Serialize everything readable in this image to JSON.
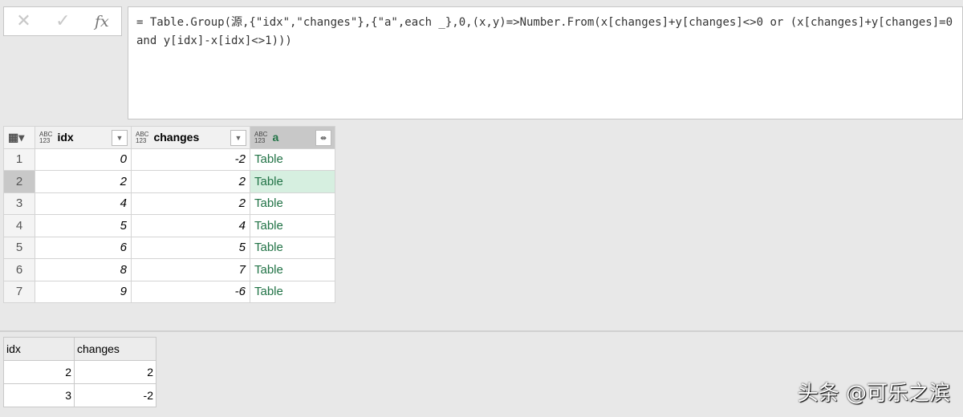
{
  "formula_bar": {
    "cancel": "✕",
    "confirm": "✓",
    "fx": "fx",
    "text": "= Table.Group(源,{\"idx\",\"changes\"},{\"a\",each _},0,(x,y)=>Number.From(x[changes]+y[changes]<>0 or (x[changes]+y[changes]=0 and y[idx]-x[idx]<>1)))"
  },
  "grid": {
    "type_label": "ABC\n123",
    "columns": [
      "idx",
      "changes",
      "a"
    ],
    "rows": [
      [
        "1",
        "0",
        "-2",
        "Table"
      ],
      [
        "2",
        "2",
        "2",
        "Table"
      ],
      [
        "3",
        "4",
        "2",
        "Table"
      ],
      [
        "4",
        "5",
        "4",
        "Table"
      ],
      [
        "5",
        "6",
        "5",
        "Table"
      ],
      [
        "6",
        "8",
        "7",
        "Table"
      ],
      [
        "7",
        "9",
        "-6",
        "Table"
      ]
    ]
  },
  "result": {
    "columns": [
      "idx",
      "changes"
    ],
    "rows": [
      [
        "2",
        "2"
      ],
      [
        "3",
        "-2"
      ]
    ]
  },
  "watermark": "头条 @可乐之滨"
}
